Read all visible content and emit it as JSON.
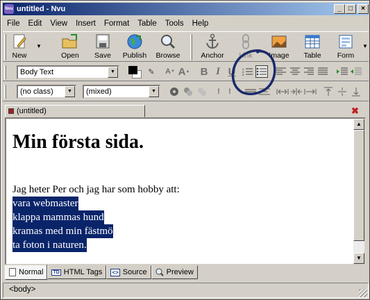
{
  "window": {
    "title": "untitled - Nvu",
    "app_badge": "Nvu"
  },
  "menu": [
    "File",
    "Edit",
    "View",
    "Insert",
    "Format",
    "Table",
    "Tools",
    "Help"
  ],
  "toolbar": {
    "new": "New",
    "open": "Open",
    "save": "Save",
    "publish": "Publish",
    "browse": "Browse",
    "anchor": "Anchor",
    "link": "Link",
    "image": "Image",
    "table": "Table",
    "form": "Form"
  },
  "format": {
    "paragraph_style": "Body Text",
    "class_select": "(no class)",
    "font_select": "(mixed)"
  },
  "document_tab": "(untitled)",
  "document": {
    "heading": "Min första sida.",
    "intro": "Jag heter Per och jag har som hobby att:",
    "items": [
      "vara webmaster",
      "klappa mammas hund",
      "kramas med min fästmö",
      "ta foton i naturen."
    ]
  },
  "view_tabs": [
    "Normal",
    "HTML Tags",
    "Source",
    "Preview"
  ],
  "status": "<body>",
  "colors": {
    "selection": "#0a246a",
    "annotation": "#1a2a6a",
    "title_bar": "#0a246a"
  }
}
